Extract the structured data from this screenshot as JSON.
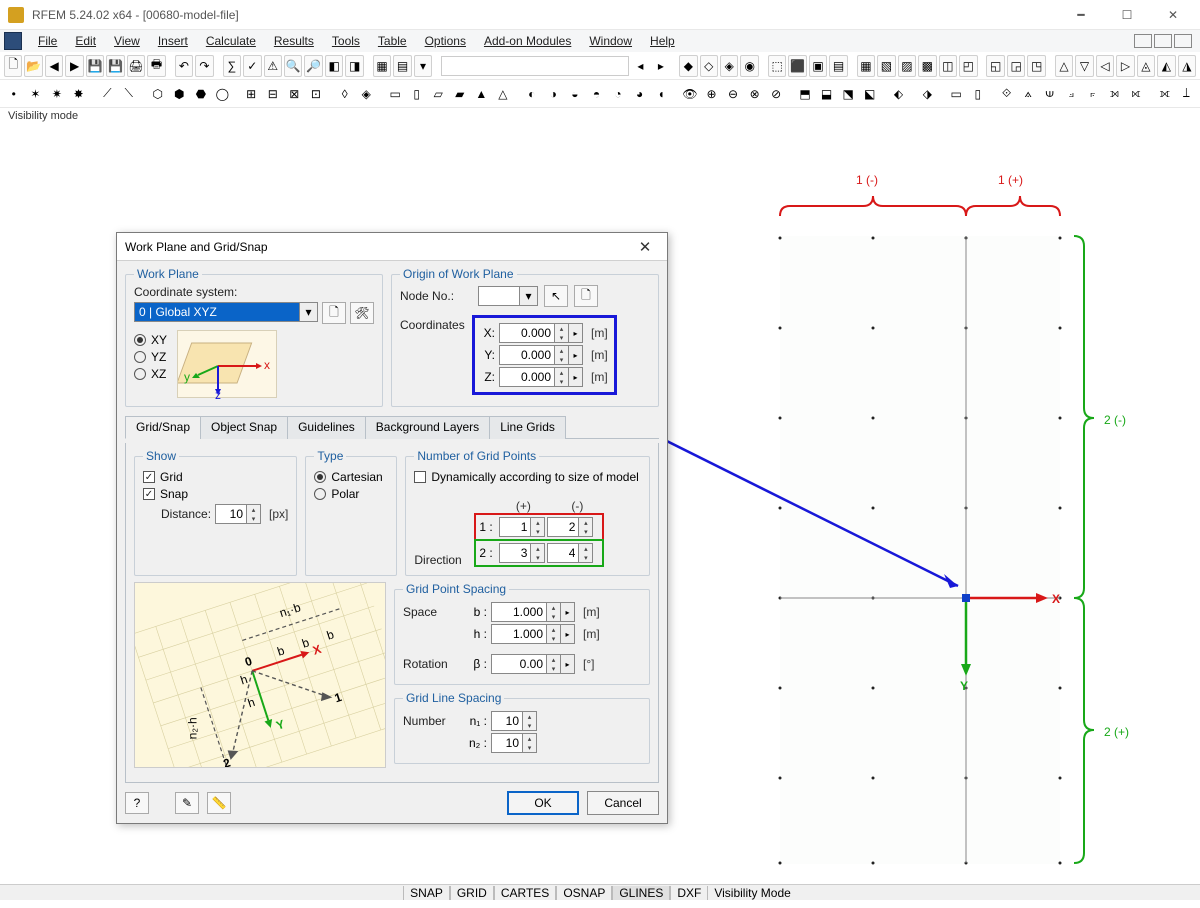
{
  "title": "RFEM 5.24.02 x64 - [00680-model-file]",
  "menu": [
    "File",
    "Edit",
    "View",
    "Insert",
    "Calculate",
    "Results",
    "Tools",
    "Table",
    "Options",
    "Add-on Modules",
    "Window",
    "Help"
  ],
  "vis_mode": "Visibility mode",
  "dialog": {
    "title": "Work Plane and Grid/Snap",
    "groups": {
      "work_plane": "Work Plane",
      "origin": "Origin of Work Plane",
      "show": "Show",
      "type": "Type",
      "num_points": "Number of Grid Points",
      "spacing": "Grid Point Spacing",
      "rotation_lbl": "Rotation",
      "line_spacing": "Grid Line Spacing"
    },
    "labels": {
      "coord_sys": "Coordinate system:",
      "node_no": "Node No.:",
      "coords": "Coordinates",
      "distance": "Distance:",
      "direction": "Direction",
      "space": "Space",
      "number": "Number",
      "dyn": "Dynamically according to size of model"
    },
    "coord_sys_sel": "0 | Global XYZ",
    "planes": {
      "xy": "XY",
      "yz": "YZ",
      "xz": "XZ"
    },
    "coords": {
      "x": "0.000",
      "y": "0.000",
      "z": "0.000",
      "unit": "[m]"
    },
    "tabs": [
      "Grid/Snap",
      "Object Snap",
      "Guidelines",
      "Background Layers",
      "Line Grids"
    ],
    "show": {
      "grid": "Grid",
      "snap": "Snap",
      "dist_val": "10",
      "dist_unit": "[px]"
    },
    "type": {
      "cartesian": "Cartesian",
      "polar": "Polar"
    },
    "grid_points": {
      "plus": "(+)",
      "minus": "(-)",
      "dir1_lbl": "1 :",
      "dir1_plus": "1",
      "dir1_minus": "2",
      "dir2_lbl": "2 :",
      "dir2_plus": "3",
      "dir2_minus": "4"
    },
    "spacing": {
      "b_lbl": "b :",
      "b_val": "1.000",
      "h_lbl": "h :",
      "h_val": "1.000",
      "unit": "[m]",
      "beta_lbl": "β :",
      "beta_val": "0.00",
      "beta_unit": "[°]"
    },
    "line_spacing": {
      "n1_lbl": "n₁ :",
      "n1_val": "10",
      "n2_lbl": "n₂ :",
      "n2_val": "10"
    },
    "buttons": {
      "ok": "OK",
      "cancel": "Cancel"
    }
  },
  "annot": {
    "one_minus": "1 (-)",
    "one_plus": "1 (+)",
    "two_minus": "2 (-)",
    "two_plus": "2 (+)",
    "axis_x": "X",
    "axis_y": "Y"
  },
  "status": [
    "SNAP",
    "GRID",
    "CARTES",
    "OSNAP",
    "GLINES",
    "DXF",
    "Visibility Mode"
  ],
  "preview_labels": {
    "origin": "0",
    "x": "X",
    "y": "Y",
    "one": "1",
    "two": "2",
    "b": "b",
    "h": "h",
    "n1b": "n₁·b",
    "n2h": "n₂·h"
  }
}
